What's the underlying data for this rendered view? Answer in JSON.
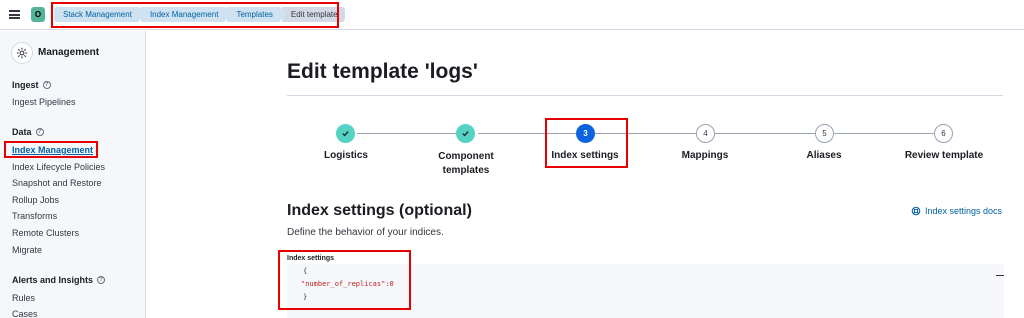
{
  "topbar": {
    "space_avatar": "O",
    "breadcrumbs": [
      "Stack Management",
      "Index Management",
      "Templates",
      "Edit template"
    ]
  },
  "sidebar": {
    "title": "Management",
    "sections": [
      {
        "title": "Ingest",
        "items": [
          "Ingest Pipelines"
        ]
      },
      {
        "title": "Data",
        "items": [
          "Index Management",
          "Index Lifecycle Policies",
          "Snapshot and Restore",
          "Rollup Jobs",
          "Transforms",
          "Remote Clusters",
          "Migrate"
        ]
      },
      {
        "title": "Alerts and Insights",
        "items": [
          "Rules",
          "Cases"
        ]
      }
    ],
    "active_item": "Index Management"
  },
  "main": {
    "page_title": "Edit template 'logs'",
    "steps": [
      {
        "number": "1",
        "label": "Logistics",
        "status": "complete"
      },
      {
        "number": "2",
        "label": "Component templates",
        "status": "complete"
      },
      {
        "number": "3",
        "label": "Index settings",
        "status": "current"
      },
      {
        "number": "4",
        "label": "Mappings",
        "status": "incomplete"
      },
      {
        "number": "5",
        "label": "Aliases",
        "status": "incomplete"
      },
      {
        "number": "6",
        "label": "Review template",
        "status": "incomplete"
      }
    ],
    "section_title": "Index settings (optional)",
    "section_description": "Define the behavior of your indices.",
    "docs_link": "Index settings docs",
    "editor": {
      "label": "Index settings",
      "lines": [
        "{",
        "\"number_of_replicas\":0",
        "}"
      ]
    }
  },
  "colors": {
    "accent": "#0b64dd",
    "complete": "#54d3c4",
    "link": "#0061a6",
    "annotation_red": "#e60000"
  }
}
